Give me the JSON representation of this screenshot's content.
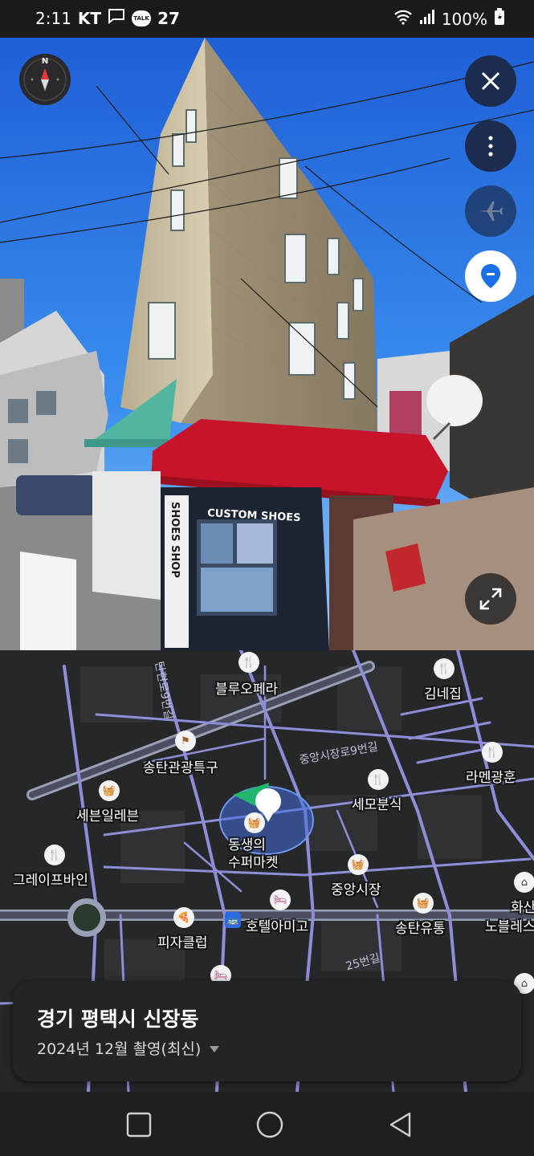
{
  "status_bar": {
    "time": "2:11",
    "carrier": "KT",
    "talk_badge": "TALK",
    "notification_count": "27",
    "battery": "100%"
  },
  "street_view": {
    "signs": {
      "custom_shoes": "CUSTOM SHOES",
      "shoes_shop": "SHOES SHOP"
    },
    "buttons": {
      "compass": "compass",
      "close": "close",
      "more": "more",
      "flight": "flight",
      "location": "location",
      "expand": "expand"
    }
  },
  "map": {
    "road_labels": [
      "중앙시장로9번길",
      "탄현로9번길",
      "25번길"
    ],
    "pois": [
      {
        "name": "블루오페라",
        "icon": "restaurant-icon"
      },
      {
        "name": "김네집",
        "icon": "restaurant-icon"
      },
      {
        "name": "송탄관광특구",
        "icon": "flag-icon"
      },
      {
        "name": "세븐일레븐",
        "icon": "shopping-icon"
      },
      {
        "name": "세모분식",
        "icon": "restaurant-icon"
      },
      {
        "name": "라멘광훈",
        "icon": "restaurant-icon"
      },
      {
        "name": "동생의\n수퍼마켓",
        "icon": "shopping-icon"
      },
      {
        "name": "그레이프바인",
        "icon": "restaurant-icon"
      },
      {
        "name": "중앙시장",
        "icon": "shopping-icon"
      },
      {
        "name": "호텔아미고",
        "icon": "hotel-icon"
      },
      {
        "name": "피자클럽",
        "icon": "pizza-icon"
      },
      {
        "name": "송탄유통",
        "icon": "shopping-icon"
      },
      {
        "name": "화산",
        "icon": "building-icon"
      },
      {
        "name": "노블레스",
        "icon": "building-icon"
      }
    ]
  },
  "info_card": {
    "location": "경기 평택시 신장동",
    "capture_info": "2024년 12월 촬영(최신)"
  },
  "colors": {
    "accent_blue": "#1a6fe8",
    "fab_bg": "#1c2c4e",
    "road_color": "#8e8ed8",
    "awning_red": "#c8142a",
    "awning_teal": "#52b5a0"
  }
}
